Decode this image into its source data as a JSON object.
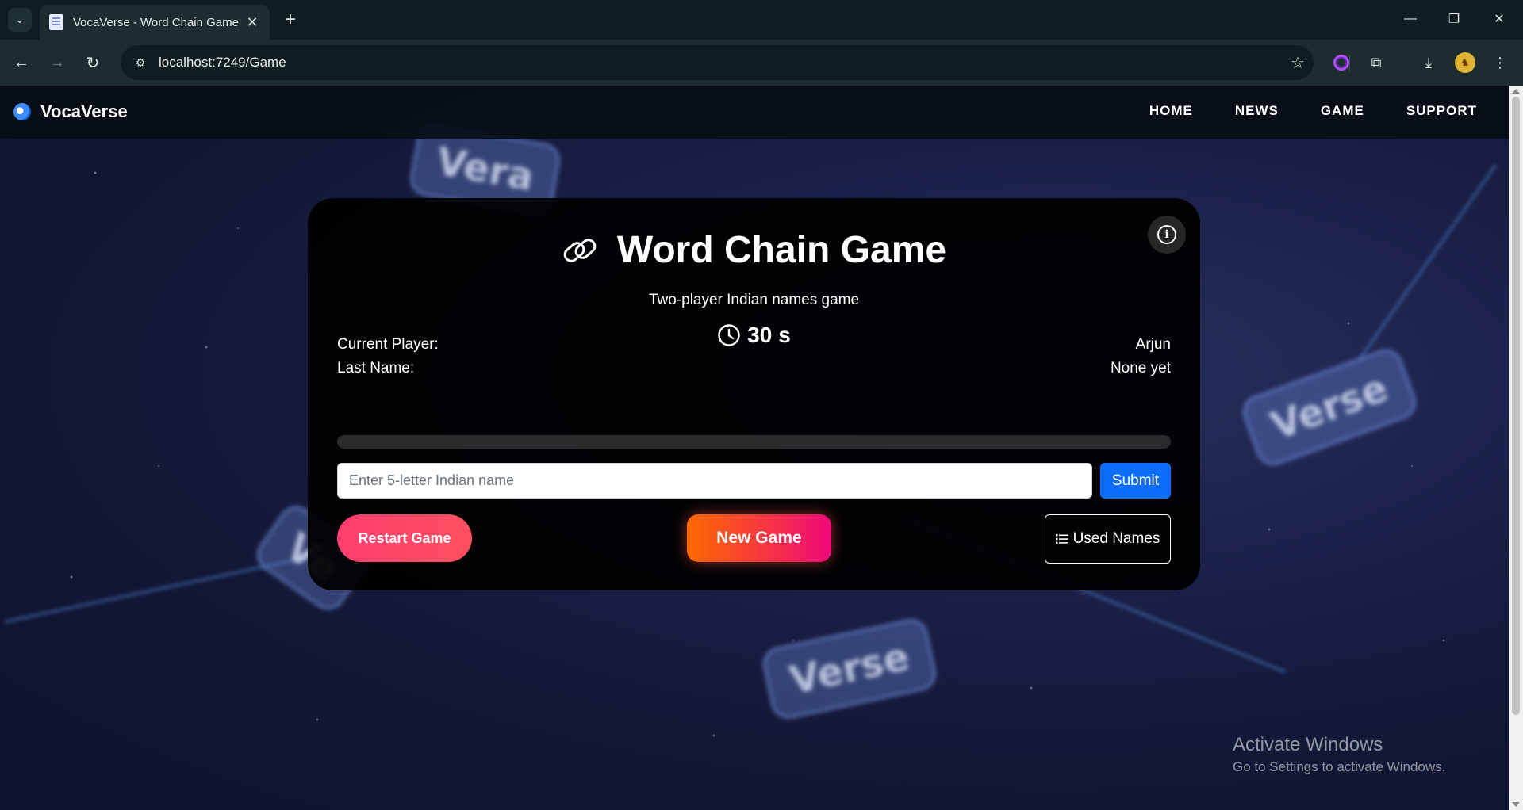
{
  "browser": {
    "tab_title": "VocaVerse - Word Chain Game",
    "url": "localhost:7249/Game",
    "tab_close": "✕",
    "new_tab": "+",
    "window_controls": {
      "minimize": "—",
      "restore": "❐",
      "close": "✕"
    }
  },
  "navbar": {
    "brand": "VocaVerse",
    "links": [
      "HOME",
      "NEWS",
      "GAME",
      "SUPPORT"
    ]
  },
  "background_badges": [
    "Vera",
    "Verse",
    "Ve",
    "Verse"
  ],
  "game": {
    "title": "Word Chain Game",
    "subtitle": "Two-player Indian names game",
    "timer_value": "30",
    "timer_unit": "s",
    "current_player_label": "Current Player:",
    "current_player_value": "Arjun",
    "last_name_label": "Last Name:",
    "last_name_value": "None yet",
    "progress_fraction": 0,
    "input_placeholder": "Enter 5-letter Indian name",
    "input_value": "",
    "submit_label": "Submit",
    "restart_label": "Restart Game",
    "new_game_label": "New Game",
    "used_names_label": "Used Names"
  },
  "watermark": {
    "line1": "Activate Windows",
    "line2": "Go to Settings to activate Windows."
  },
  "colors": {
    "submit": "#0d6efd",
    "restart": "#ff4065",
    "new_game_start": "#ff6a00",
    "new_game_end": "#ee0979",
    "card_bg": "#000000"
  }
}
